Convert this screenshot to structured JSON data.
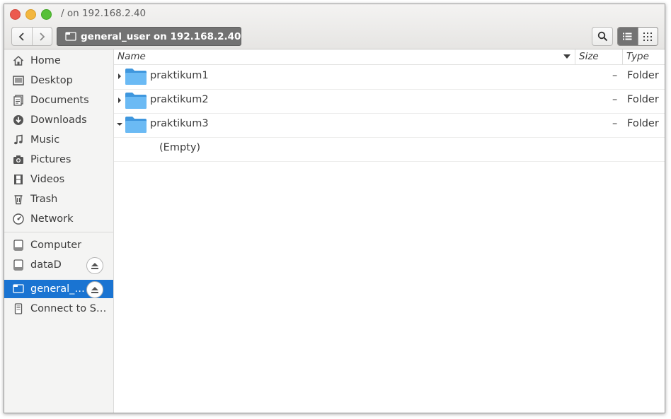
{
  "window": {
    "title": "/ on 192.168.2.40"
  },
  "toolbar": {
    "back_icon": "chevron-left-icon",
    "forward_icon": "chevron-right-icon",
    "path_label": "general_user on 192.168.2.40",
    "search_icon": "search-icon",
    "list_view_icon": "list-view-icon",
    "grid_view_icon": "grid-view-icon"
  },
  "sidebar": {
    "places": [
      {
        "label": "Home",
        "icon": "home-icon"
      },
      {
        "label": "Desktop",
        "icon": "desktop-icon"
      },
      {
        "label": "Documents",
        "icon": "documents-icon"
      },
      {
        "label": "Downloads",
        "icon": "downloads-icon"
      },
      {
        "label": "Music",
        "icon": "music-icon"
      },
      {
        "label": "Pictures",
        "icon": "camera-icon"
      },
      {
        "label": "Videos",
        "icon": "film-icon"
      },
      {
        "label": "Trash",
        "icon": "trash-icon"
      },
      {
        "label": "Network",
        "icon": "network-icon"
      }
    ],
    "devices": [
      {
        "label": "Computer",
        "icon": "drive-icon",
        "eject": false
      },
      {
        "label": "dataD",
        "icon": "drive-icon",
        "eject": true
      },
      {
        "label": "general_…",
        "icon": "network-folder-icon",
        "eject": true,
        "selected": true
      },
      {
        "label": "Connect to S…",
        "icon": "server-icon",
        "eject": false
      }
    ]
  },
  "columns": {
    "name": "Name",
    "size": "Size",
    "type": "Type"
  },
  "files": [
    {
      "name": "praktikum1",
      "size": "–",
      "type": "Folder",
      "expanded": false
    },
    {
      "name": "praktikum2",
      "size": "–",
      "type": "Folder",
      "expanded": false
    },
    {
      "name": "praktikum3",
      "size": "–",
      "type": "Folder",
      "expanded": true
    }
  ],
  "empty_label": "(Empty)",
  "colors": {
    "selection": "#1a74d2",
    "path_button": "#727272",
    "folder": "#5aaef0"
  }
}
